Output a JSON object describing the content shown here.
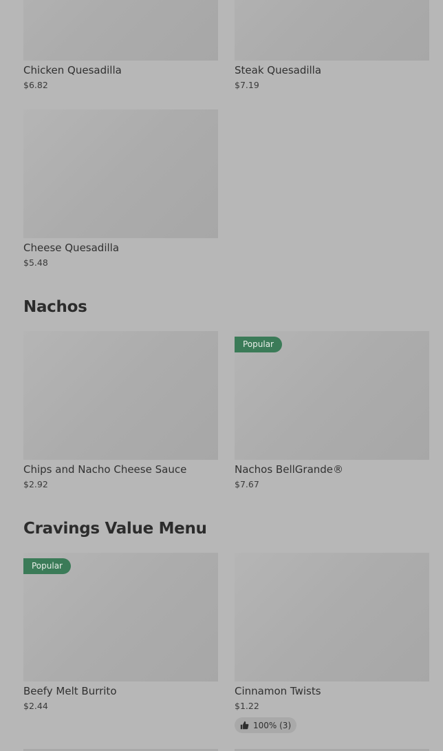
{
  "items": {
    "chicken_quesadilla": {
      "name": "Chicken Quesadilla",
      "price": "$6.82"
    },
    "steak_quesadilla": {
      "name": "Steak Quesadilla",
      "price": "$7.19"
    },
    "cheese_quesadilla": {
      "name": "Cheese Quesadilla",
      "price": "$5.48"
    },
    "chips_nacho_cheese": {
      "name": "Chips and Nacho Cheese Sauce",
      "price": "$2.92"
    },
    "nachos_bellgrande": {
      "name": "Nachos BellGrande®",
      "price": "$7.67",
      "badge": "Popular"
    },
    "beefy_melt_burrito": {
      "name": "Beefy Melt Burrito",
      "price": "$2.44",
      "badge": "Popular"
    },
    "cinnamon_twists": {
      "name": "Cinnamon Twists",
      "price": "$1.22",
      "rating": "100% (3)"
    }
  },
  "sections": {
    "nachos": {
      "title": "Nachos"
    },
    "cravings": {
      "title": "Cravings Value Menu"
    }
  },
  "icons": {
    "rating": "thumbs-up-icon"
  },
  "colors": {
    "badge_bg": "#3b7b58",
    "page_bg": "#b7b7b7"
  }
}
